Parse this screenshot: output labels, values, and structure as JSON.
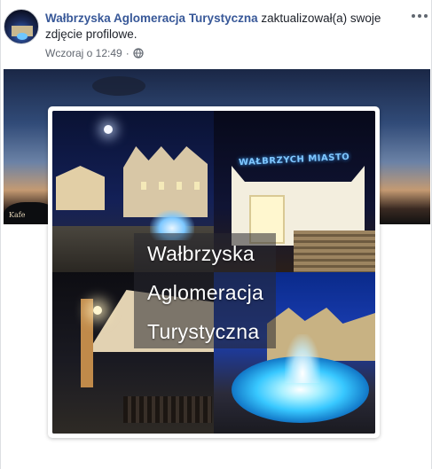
{
  "post": {
    "page_name": "Wałbrzyska Aglomeracja Turystyczna",
    "action_text": " zaktualizował(a) swoje zdjęcie profilowe.",
    "timestamp": "Wczoraj o 12:49",
    "separator": "·",
    "privacy_icon": "globe-icon",
    "more_icon": "more-options-icon"
  },
  "profile_picture": {
    "lines": [
      "Wałbrzyska",
      "Aglomeracja",
      "Turystyczna"
    ],
    "neon_sign": "WAŁBRZYCH MIASTO"
  },
  "cover": {
    "corner_tag": "Kafe"
  },
  "colors": {
    "link": "#385898",
    "meta": "#616770",
    "text": "#1d2129"
  }
}
